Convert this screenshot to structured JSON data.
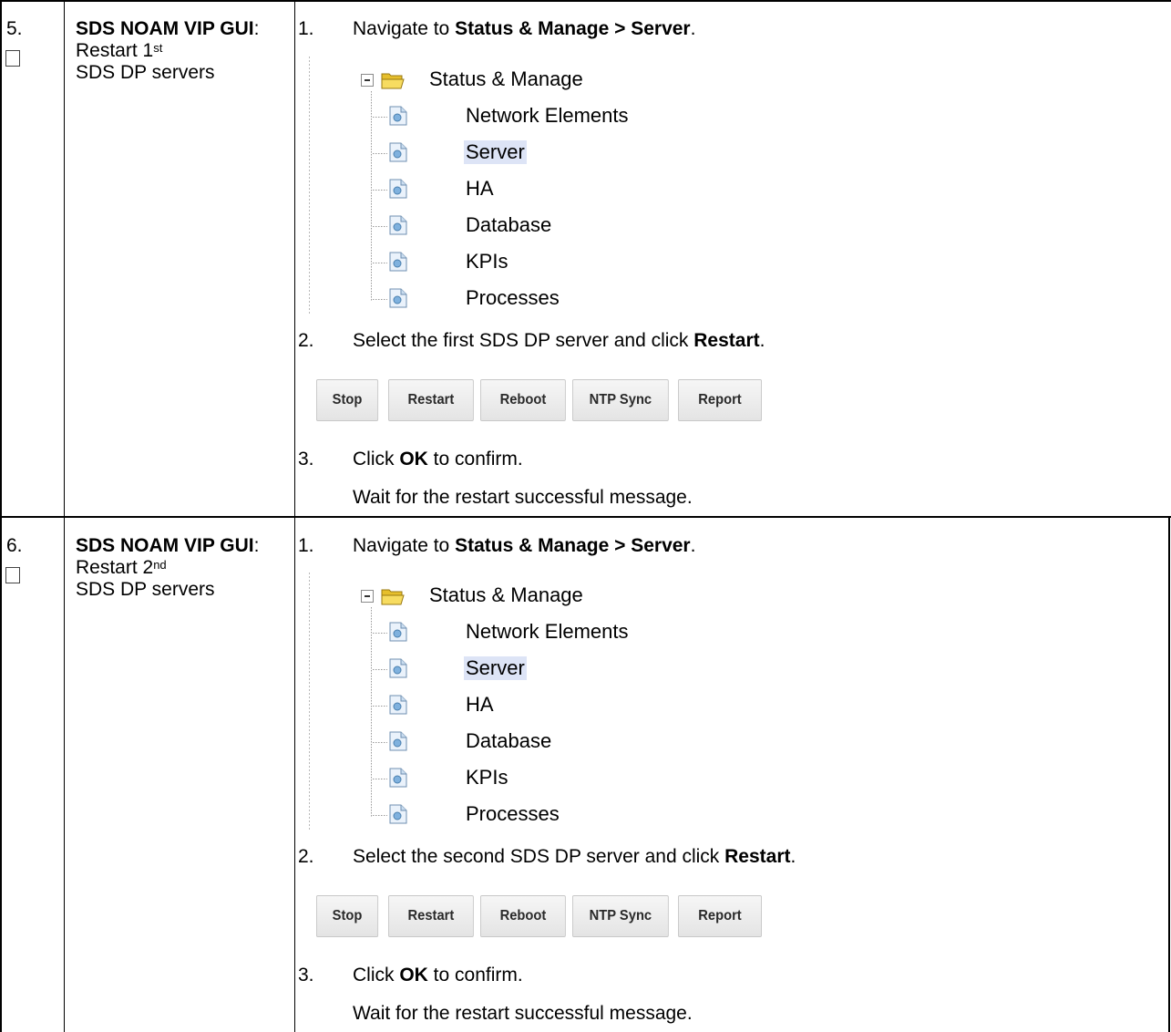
{
  "steps": [
    {
      "number": "5.",
      "title_bold": "SDS NOAM VIP GUI",
      "title_rest": ": Restart 1",
      "title_sup": "st",
      "title_tail": "SDS DP servers",
      "instructions": [
        {
          "num": "1.",
          "pre": "Navigate to ",
          "bold": "Status & Manage > Server",
          "post": "."
        },
        {
          "num": "2.",
          "pre": "Select the first SDS DP server and click ",
          "bold": "Restart",
          "post": "."
        },
        {
          "num": "3.",
          "pre": "Click ",
          "bold": "OK",
          "post": " to confirm."
        }
      ],
      "note": "Wait for the restart successful message."
    },
    {
      "number": "6.",
      "title_bold": "SDS NOAM VIP GUI",
      "title_rest": ": Restart 2",
      "title_sup": "nd",
      "title_tail": "SDS DP servers",
      "instructions": [
        {
          "num": "1.",
          "pre": "Navigate to ",
          "bold": "Status & Manage > Server",
          "post": "."
        },
        {
          "num": "2.",
          "pre": "Select the second SDS DP server and click ",
          "bold": "Restart",
          "post": "."
        },
        {
          "num": "3.",
          "pre": "Click ",
          "bold": "OK",
          "post": " to confirm."
        }
      ],
      "note": "Wait for the restart successful message."
    }
  ],
  "tree": {
    "root": "Status & Manage",
    "items": [
      "Network Elements",
      "Server",
      "HA",
      "Database",
      "KPIs",
      "Processes"
    ],
    "selected": "Server",
    "icons": {
      "root": "folder-open-icon",
      "item": "page-icon",
      "toggle": "collapse-minus-icon"
    }
  },
  "buttons": [
    "Stop",
    "Restart",
    "Reboot",
    "NTP Sync",
    "Report"
  ],
  "colors": {
    "selection": "#dde4f6",
    "folder": "#f2d04b",
    "button_border": "#c7c7c7"
  }
}
